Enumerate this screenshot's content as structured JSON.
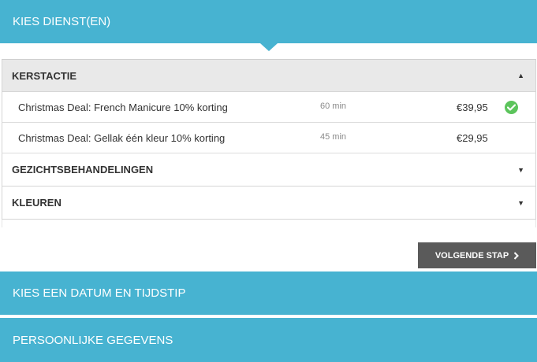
{
  "steps": [
    {
      "title": "KIES DIENST(EN)"
    },
    {
      "title": "KIES EEN DATUM EN TIJDSTIP"
    },
    {
      "title": "PERSOONLIJKE GEGEVENS"
    }
  ],
  "categories": [
    {
      "name": "KERSTACTIE",
      "expanded": true,
      "caret_icon": "caret-up-icon",
      "services": [
        {
          "name": "Christmas Deal: French Manicure 10% korting",
          "duration": "60 min",
          "price": "€39,95",
          "selected": true
        },
        {
          "name": "Christmas Deal: Gellak één kleur 10% korting",
          "duration": "45 min",
          "price": "€29,95",
          "selected": false
        }
      ]
    },
    {
      "name": "GEZICHTSBEHANDELINGEN",
      "expanded": false,
      "caret_icon": "caret-down-icon"
    },
    {
      "name": "KLEUREN",
      "expanded": false,
      "caret_icon": "caret-down-icon"
    }
  ],
  "next_button": {
    "label": "VOLGENDE STAP",
    "icon": "chevron-right-icon"
  },
  "colors": {
    "accent": "#47b3d1",
    "button": "#5a5a5a",
    "check": "#5cc45c",
    "open_category_bg": "#e9e9e9"
  }
}
